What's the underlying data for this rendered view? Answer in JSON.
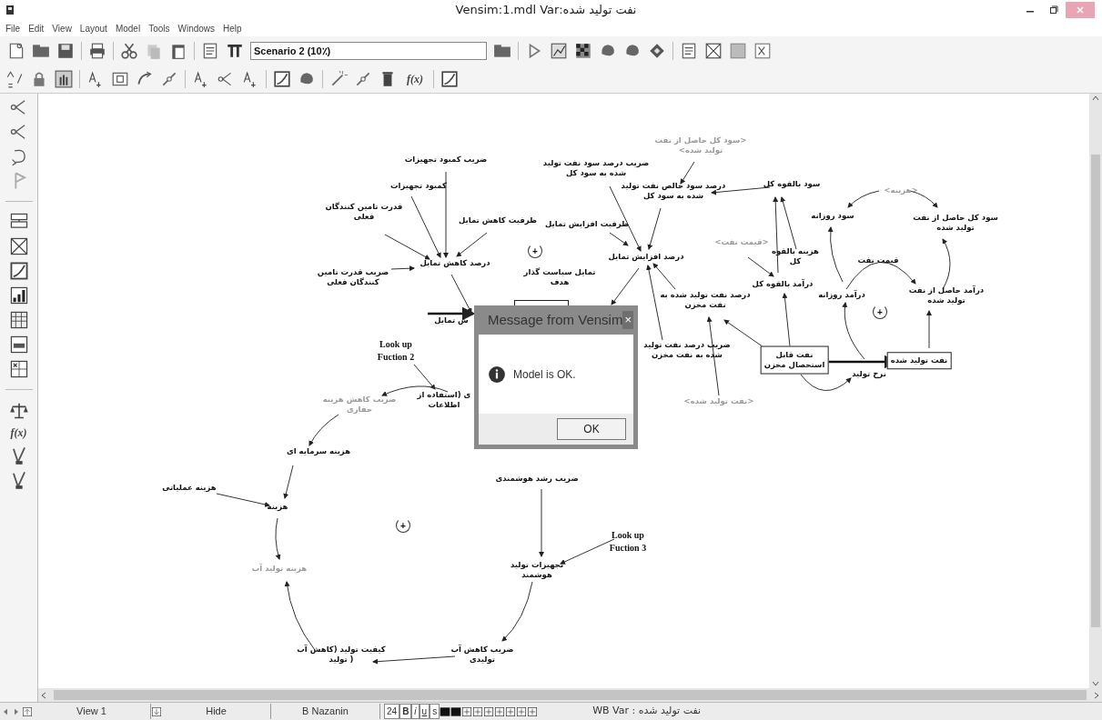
{
  "window": {
    "title": "Vensim:1.mdl Var:نفت تولید شده"
  },
  "menu": {
    "file": "File",
    "edit": "Edit",
    "view": "View",
    "layout": "Layout",
    "model": "Model",
    "tools": "Tools",
    "windows": "Windows",
    "help": "Help"
  },
  "toolbar": {
    "scenario": "Scenario 2 (10٪)"
  },
  "sketch_toolbar": {
    "function_label": "f(x)"
  },
  "side_toolbar": {
    "function_label": "f(x)"
  },
  "diagram": {
    "variables": [
      {
        "text": "<سود کل حاصل از نفت\nتولید شده>",
        "kind": "shadow"
      },
      {
        "text": "ضریب درصد سود نفت تولید\nشده به سود کل",
        "kind": "plain"
      },
      {
        "text": "ضریب کمبود تجهیزات",
        "kind": "plain"
      },
      {
        "text": "<هزینه>",
        "kind": "shadow"
      },
      {
        "text": "سود بالقوه کل",
        "kind": "plain"
      },
      {
        "text": "درصد سود خالص نفت تولید\nشده به سود کل",
        "kind": "plain"
      },
      {
        "text": "کمبود تجهیزات",
        "kind": "plain"
      },
      {
        "text": "سود کل حاصل از نفت\nتولید شده",
        "kind": "plain"
      },
      {
        "text": "سود روزانه",
        "kind": "plain"
      },
      {
        "text": "ظرفیت افزایش تمایل",
        "kind": "plain"
      },
      {
        "text": "ظرفیت کاهش تمایل",
        "kind": "plain"
      },
      {
        "text": "قدرت تامین کنندگان\nفعلی",
        "kind": "plain"
      },
      {
        "text": "<قیمت نفت>",
        "kind": "shadow"
      },
      {
        "text": "قیمت نفت",
        "kind": "plain"
      },
      {
        "text": "هزینه بالقوه\nکل",
        "kind": "plain"
      },
      {
        "text": "درصد افزایش تمایل",
        "kind": "plain"
      },
      {
        "text": "درصد کاهش تمایل",
        "kind": "plain"
      },
      {
        "text": "درآمد بالقوه کل",
        "kind": "plain"
      },
      {
        "text": "تمایل سیاست گذار\nهدف",
        "kind": "plain"
      },
      {
        "text": "ضریب قدرت تامین\nکنندگان فعلی",
        "kind": "plain"
      },
      {
        "text": "درآمد حاصل از نفت\nتولید شده",
        "kind": "plain"
      },
      {
        "text": "درآمد روزانه",
        "kind": "plain"
      },
      {
        "text": "درصد نفت تولید شده به\nنفت مخزن",
        "kind": "plain"
      },
      {
        "text": "ش تمایل",
        "kind": "plain"
      },
      {
        "text": "نفت تولید شده",
        "kind": "stock"
      },
      {
        "text": "نفت قابل\nاستحصال مخزن",
        "kind": "stock"
      },
      {
        "text": "ضریب درصد نفت تولید\nشده به نفت مخزن",
        "kind": "plain"
      },
      {
        "text": "Look up\nFuction 2",
        "kind": "lookup"
      },
      {
        "text": "نرخ تولید",
        "kind": "plain"
      },
      {
        "text": "<نفت تولید شده>",
        "kind": "shadow"
      },
      {
        "text": "ی (استفاده از\nاطلاعات",
        "kind": "plain"
      },
      {
        "text": "ضریب کاهش هزینه\nحفاری",
        "kind": "shadow"
      },
      {
        "text": "هزینه سرمایه ای",
        "kind": "plain"
      },
      {
        "text": "ضریب رشد هوشمندی",
        "kind": "plain"
      },
      {
        "text": "هزینه عملیاتی",
        "kind": "plain"
      },
      {
        "text": "هزینه",
        "kind": "plain"
      },
      {
        "text": "Look up\nFuction 3",
        "kind": "lookup"
      },
      {
        "text": "تجهیزات تولید\nهوشمند",
        "kind": "plain"
      },
      {
        "text": "هزینه تولید آب",
        "kind": "shadow"
      },
      {
        "text": "ضریب کاهش آب\nتولیدی",
        "kind": "plain"
      },
      {
        "text": "کیفیت تولید (کاهش آب\n( تولید",
        "kind": "plain"
      }
    ],
    "loop_markers": [
      "+",
      "+",
      "+"
    ]
  },
  "dialog": {
    "title": "Message from Vensim",
    "close": "×",
    "message": "Model is OK.",
    "button": "OK"
  },
  "status_bar": {
    "view": "View 1",
    "hide": "Hide",
    "font": "B Nazanin",
    "size": "24",
    "styles": {
      "bold": "B",
      "italic": "i",
      "underline": "u",
      "strikeout": "s"
    },
    "variable": "WB Var : نفت تولید شده"
  }
}
